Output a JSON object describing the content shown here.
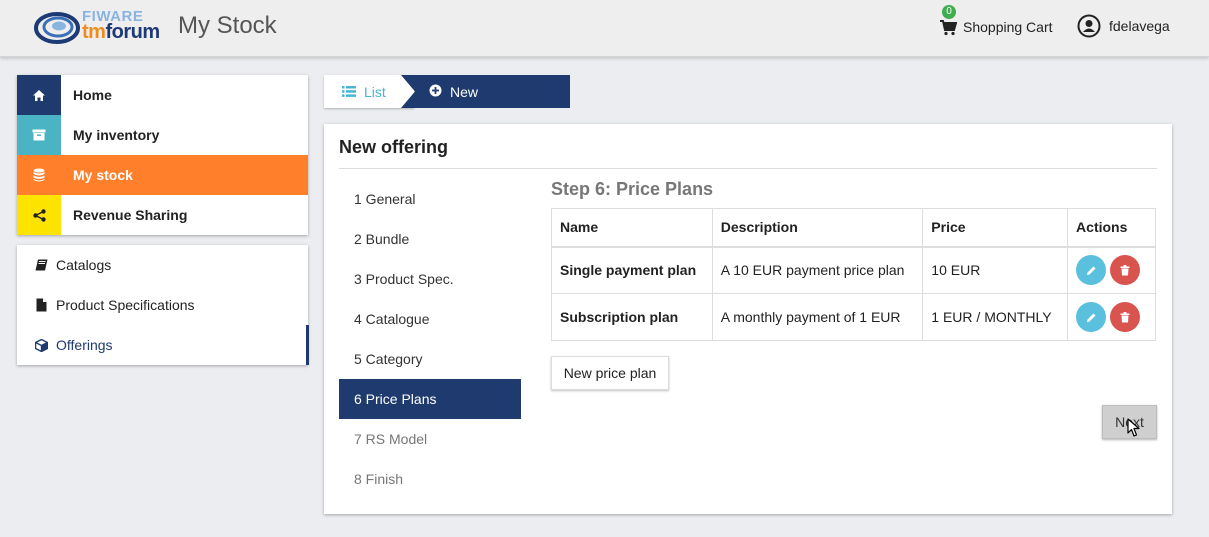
{
  "header": {
    "logo_fiware": "FIWARE",
    "logo_tm": "tm",
    "logo_forum": "forum",
    "app_title": "My Stock",
    "cart_count": "0",
    "cart_label": "Shopping Cart",
    "user_name": "fdelavega"
  },
  "sidebar": {
    "main_items": [
      {
        "label": "Home",
        "icon": "home-icon",
        "color": "#1e3a6e"
      },
      {
        "label": "My inventory",
        "icon": "archive-icon",
        "color": "#4ab4c4"
      },
      {
        "label": "My stock",
        "icon": "database-icon",
        "color": "#ff7f2a"
      },
      {
        "label": "Revenue Sharing",
        "icon": "share-icon",
        "color": "#fde400"
      }
    ],
    "sub_items": [
      {
        "label": "Catalogs",
        "icon": "book-icon"
      },
      {
        "label": "Product Specifications",
        "icon": "file-icon"
      },
      {
        "label": "Offerings",
        "icon": "cube-icon"
      }
    ]
  },
  "breadcrumb": {
    "list_label": "List",
    "new_label": "New"
  },
  "panel": {
    "title": "New offering",
    "step_title": "Step 6: Price Plans",
    "steps": [
      "1 General",
      "2 Bundle",
      "3 Product Spec.",
      "4 Catalogue",
      "5 Category",
      "6 Price Plans",
      "7 RS Model",
      "8 Finish"
    ],
    "active_step": 5,
    "table": {
      "headers": [
        "Name",
        "Description",
        "Price",
        "Actions"
      ],
      "rows": [
        {
          "name": "Single payment plan",
          "description": "A 10 EUR payment price plan",
          "price": "10 EUR"
        },
        {
          "name": "Subscription plan",
          "description": "A monthly payment of 1 EUR",
          "price": "1 EUR / MONTHLY"
        }
      ]
    },
    "new_plan_label": "New price plan",
    "next_label": "Next"
  },
  "colors": {
    "brand_navy": "#1e3a6e",
    "accent_orange": "#ff7f2a",
    "edit_blue": "#5bc0de",
    "delete_red": "#d9534f"
  }
}
